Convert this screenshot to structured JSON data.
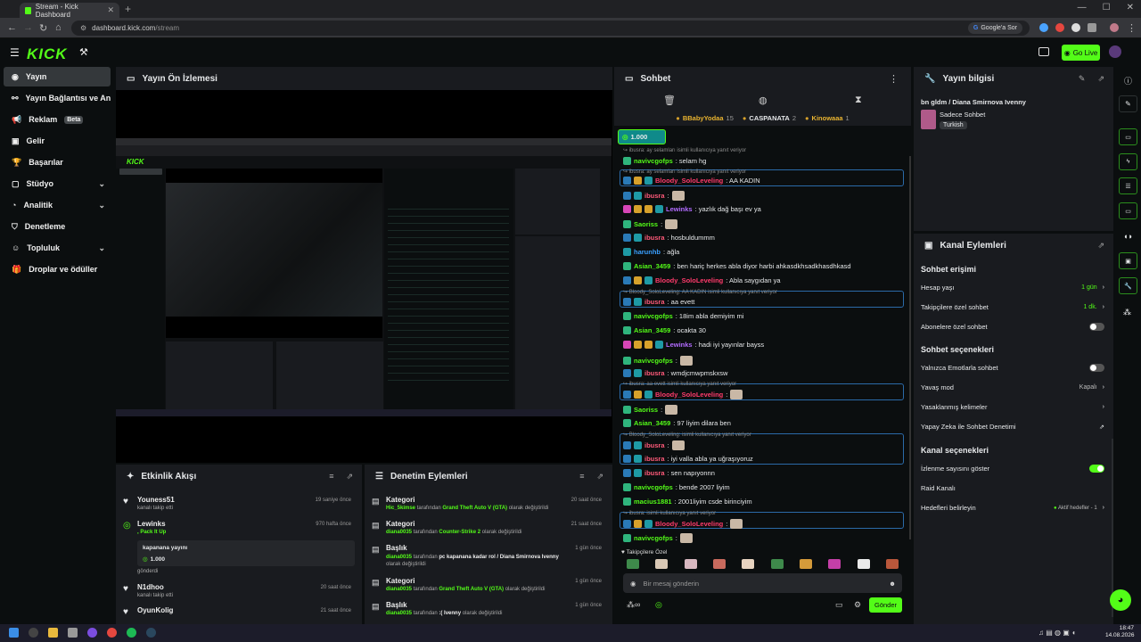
{
  "browser": {
    "tab_title": "Stream - Kick Dashboard",
    "url_host": "dashboard.kick.com",
    "url_path": "/stream",
    "google_label": "Google'a Sor"
  },
  "kick": {
    "logo": "KICK",
    "go_live": "Go Live"
  },
  "sidebar": {
    "items": [
      {
        "label": "Yayın",
        "icon": "broadcast-icon"
      },
      {
        "label": "Yayın Bağlantısı ve Anahtar",
        "icon": "link-icon"
      },
      {
        "label": "Reklam",
        "badge": "Beta",
        "icon": "megaphone-icon"
      },
      {
        "label": "Gelir",
        "icon": "money-icon"
      },
      {
        "label": "Başarılar",
        "icon": "trophy-icon"
      },
      {
        "label": "Stüdyo",
        "icon": "studio-icon"
      },
      {
        "label": "Analitik",
        "icon": "analytics-icon"
      },
      {
        "label": "Denetleme",
        "icon": "shield-icon"
      },
      {
        "label": "Topluluk",
        "icon": "community-icon"
      },
      {
        "label": "Droplar ve ödüller",
        "icon": "gift-icon"
      }
    ]
  },
  "preview": {
    "title": "Yayın Ön İzlemesi"
  },
  "activity": {
    "title": "Etkinlik Akışı",
    "items": [
      {
        "name": "Youness51",
        "sub": "kanalı takip etti",
        "time": "19 saniye önce"
      },
      {
        "name": "Lewinks",
        "sub": ", Pack It Up",
        "time": "970 hafta önce",
        "note": "kapanana yayını",
        "amount": "1.000",
        "after": "gönderdi"
      },
      {
        "name": "N1dhoo",
        "sub": "kanalı takip etti",
        "time": "20 saat önce"
      },
      {
        "name": "OyunKolig",
        "sub": "",
        "time": "21 saat önce"
      }
    ]
  },
  "moderation": {
    "title": "Denetim Eylemleri",
    "items": [
      {
        "kind": "Kategori",
        "user": "Hic_5kimse",
        "mid": " tarafından ",
        "target": "Grand Theft Auto V (GTA)",
        "tail": " olarak değiştirildi",
        "time": "20 saat önce"
      },
      {
        "kind": "Kategori",
        "user": "diana0035",
        "mid": " tarafından ",
        "target": "Counter-Strike 2",
        "tail": " olarak değiştirildi",
        "time": "21 saat önce"
      },
      {
        "kind": "Başlık",
        "user": "diana0035",
        "mid": " tarafından ",
        "target": "pc kapanana kadar rol / Diana Smirnova Ivenny",
        "tail": " olarak değiştirildi",
        "time": "1 gün önce"
      },
      {
        "kind": "Kategori",
        "user": "diana0035",
        "mid": " tarafından ",
        "target": "Grand Theft Auto V (GTA)",
        "tail": " olarak değiştirildi",
        "time": "1 gün önce"
      },
      {
        "kind": "Başlık",
        "user": "diana0035",
        "mid": " tarafından ",
        "target": ":( Ivenny",
        "tail": " olarak değiştirildi",
        "time": "1 gün önce"
      }
    ]
  },
  "chat": {
    "title": "Sohbet",
    "top_gifters": [
      {
        "name": "BBabyYodaa",
        "count": "15"
      },
      {
        "name": "CASPANATA",
        "count": "2"
      },
      {
        "name": "Kinowaaa",
        "count": "1"
      }
    ],
    "pinned_amount": "1.000",
    "messages": [
      {
        "reply": "ibusra: ay selamları isimli kullanıcıya yanıt veriyor"
      },
      {
        "user": "navivcgofps",
        "text": ": selam hg",
        "color": "#53fc18"
      },
      {
        "reply": "ibusra: ay selamları isimli kullanıcıya yanıt veriyor"
      },
      {
        "user": "Bloody_SoloLeveling",
        "text": ": AA KADIN",
        "color": "#ff3b6b"
      },
      {
        "user": "ibusra",
        "text": ":",
        "color": "#ff5a7a"
      },
      {
        "user": "Lewinks",
        "text": ": yazlık dağ başı ev ya",
        "color": "#b26bff"
      },
      {
        "user": "Saoriss",
        "text": ":",
        "color": "#53fc18"
      },
      {
        "user": "ibusra",
        "text": ": hosbuldummm",
        "color": "#ff5a7a"
      },
      {
        "user": "harunhb",
        "text": ": ağla",
        "color": "#3aa0ff"
      },
      {
        "user": "Asian_3459",
        "text": ": ben hariç herkes abla diyor harbi ahkasdkhsadkhasdhkasd",
        "color": "#53fc18"
      },
      {
        "user": "Bloody_SoloLeveling",
        "text": ": Abla saygıdan ya",
        "color": "#ff3b6b"
      },
      {
        "reply": "Bloody_SoloLeveling: AA KADIN isimli kullanıcıya yanıt veriyor"
      },
      {
        "user": "ibusra",
        "text": ": aa evett",
        "color": "#ff5a7a"
      },
      {
        "user": "navivcgofps",
        "text": ": 18im abla demiyim mi",
        "color": "#53fc18"
      },
      {
        "user": "Asian_3459",
        "text": ": ocakta 30",
        "color": "#53fc18"
      },
      {
        "user": "Lewinks",
        "text": ": hadi iyi yayınlar bayss",
        "color": "#b26bff"
      },
      {
        "user": "navivcgofps",
        "text": ":",
        "color": "#53fc18"
      },
      {
        "user": "ibusra",
        "text": ": wmdjcmwpmskxsw",
        "color": "#ff5a7a"
      },
      {
        "reply": "ibusra: aa evett isimli kullanıcıya yanıt veriyor"
      },
      {
        "user": "Bloody_SoloLeveling",
        "text": ":",
        "color": "#ff3b6b"
      },
      {
        "user": "Saoriss",
        "text": ":",
        "color": "#53fc18"
      },
      {
        "user": "Asian_3459",
        "text": ": 97 liyim dilara ben",
        "color": "#53fc18"
      },
      {
        "reply": "Bloody_SoloLeveling: isimli kullanıcıya yanıt veriyor"
      },
      {
        "user": "ibusra",
        "text": ":",
        "color": "#ff5a7a"
      },
      {
        "user": "ibusra",
        "text": ": iyi valla abla ya uğraşıyoruz",
        "color": "#ff5a7a"
      },
      {
        "user": "ibusra",
        "text": ": sen napıyonnn",
        "color": "#ff5a7a"
      },
      {
        "user": "navivcgofps",
        "text": ": bende 2007 liyim",
        "color": "#53fc18"
      },
      {
        "user": "macius1881",
        "text": ": 2001liyim csde birinciyim",
        "color": "#53fc18"
      },
      {
        "reply": "ibusra: isimli kullanıcıya yanıt veriyor"
      },
      {
        "user": "Bloody_SoloLeveling",
        "text": ":",
        "color": "#ff3b6b"
      },
      {
        "user": "navivcgofps",
        "text": ":",
        "color": "#53fc18"
      }
    ],
    "emote_tab": "Takipçilere Özel",
    "input_placeholder": "Bir mesaj gönderin",
    "send_label": "Gönder"
  },
  "info": {
    "title": "Yayın bilgisi",
    "stream_title": "bn gldm / Diana Smirnova Ivenny",
    "category": "Sadece Sohbet",
    "language": "Turkish"
  },
  "actions": {
    "title": "Kanal Eylemleri",
    "sec1": "Sohbet erişimi",
    "account_age": "Hesap yaşı",
    "account_age_val": "1 gün",
    "followers_chat": "Takipçilere özel sohbet",
    "followers_chat_val": "1 dk.",
    "subs_chat": "Abonelere özel sohbet",
    "sec2": "Sohbet seçenekleri",
    "emote_only": "Yalnızca Emotlarla sohbet",
    "slow_mode": "Yavaş mod",
    "slow_mode_val": "Kapalı",
    "banned_words": "Yasaklanmış kelimeler",
    "ai_mod": "Yapay Zeka ile Sohbet Denetimi",
    "sec3": "Kanal seçenekleri",
    "viewer_count": "İzlenme sayısını göster",
    "raid": "Raid Kanalı",
    "goals": "Hedefleri belirleyin",
    "goals_val": "Aktif hedefler - 1"
  },
  "taskbar": {
    "time": "18:47",
    "date": "14.08.2026"
  }
}
